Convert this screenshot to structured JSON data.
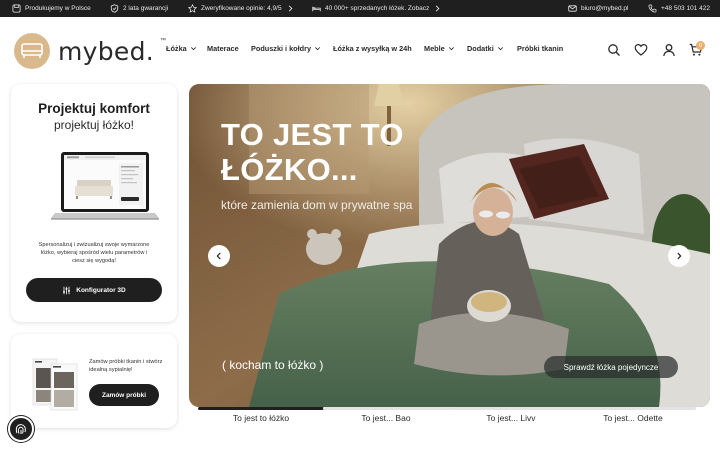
{
  "topbar": {
    "made_in_poland": "Produkujemy w Polsce",
    "warranty": "2 lata gwarancji",
    "reviews": "Zweryfikowane opinie: 4,9/5",
    "sold_beds": "40 000+ sprzedanych łóżek. Zobacz",
    "email": "biuro@mybed.pl",
    "phone": "+48 503 101 422"
  },
  "header": {
    "logo_text": "mybed.",
    "logo_tm": "™",
    "nav": [
      {
        "label": "Łóżka",
        "has_dropdown": true
      },
      {
        "label": "Materace",
        "has_dropdown": false
      },
      {
        "label": "Poduszki i kołdry",
        "has_dropdown": true
      },
      {
        "label": "Łóżka z wysyłką w 24h",
        "has_dropdown": false
      },
      {
        "label": "Meble",
        "has_dropdown": true
      },
      {
        "label": "Dodatki",
        "has_dropdown": true
      },
      {
        "label": "Próbki tkanin",
        "has_dropdown": false
      }
    ],
    "icons": [
      "search-icon",
      "heart-icon",
      "user-icon",
      "cart-icon"
    ],
    "cart_count": "0"
  },
  "configurator_card": {
    "title": "Projektuj komfort",
    "subtitle": "projektuj łóżko!",
    "description": "Spersonalizuj i zwizualizuj swoje wymarzone łóżko, wybieraj spośród wielu parametrów i ciesz się wygodą!",
    "button_label": "Konfigurator 3D"
  },
  "samples_card": {
    "description": "Zamów próbki tkanin i stwórz idealną sypialnię!",
    "button_label": "Zamów próbki"
  },
  "hero": {
    "title_line1": "TO JEST TO",
    "title_line2": "ŁÓŻKO...",
    "subtitle": "które zamienia dom w prywatne spa",
    "tagline": "( kocham to łóżko )",
    "cta_label": "Sprawdź łóżka pojedyncze"
  },
  "slider_tabs": [
    {
      "label": "To jest to łóżko",
      "active": true
    },
    {
      "label": "To jest... Bao",
      "active": false
    },
    {
      "label": "To jest... Livv",
      "active": false
    },
    {
      "label": "To jest... Odette",
      "active": false
    }
  ],
  "colors": {
    "topbar_bg": "#1f1f1f",
    "accent_gold": "#d9b98b",
    "button_dark": "#1f1f1f"
  }
}
